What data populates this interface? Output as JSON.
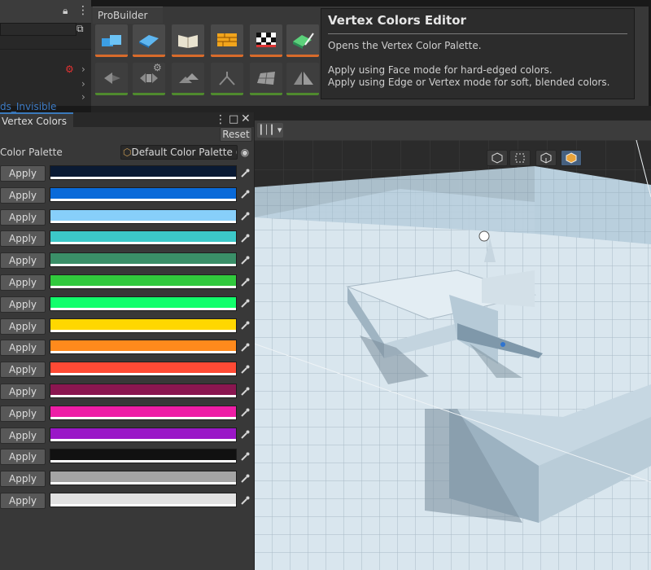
{
  "probuilder": {
    "tab_label": "ProBuilder",
    "tool_icons_row1": [
      "new-shape-icon",
      "new-poly-shape-icon",
      "uv-editor-icon",
      "smoothing-icon",
      "material-editor-icon",
      "vertex-colors-icon"
    ],
    "tool_icons_row2": [
      "select-face-loop-icon",
      "extrude-icon",
      "merge-icon",
      "weld-icon",
      "subdivide-icon",
      "flip-icon"
    ]
  },
  "tooltip": {
    "title": "Vertex Colors Editor",
    "line1": "Opens the Vertex Color Palette.",
    "line2": "Apply using Face mode for hard-edged colors.",
    "line3": "Apply using Edge or Vertex mode for soft, blended colors."
  },
  "hierarchy": {
    "link_text": "ds_Invisible"
  },
  "vertex_colors": {
    "tab_label": "Vertex Colors",
    "reset_label": "Reset",
    "palette_label": "Color Palette",
    "palette_value": "Default Color Palette (",
    "apply_label": "Apply",
    "colors": [
      "#0a1a33",
      "#0a6ad9",
      "#87cffa",
      "#3cc8c8",
      "#3a8f68",
      "#31c93d",
      "#12ff6c",
      "#ffd700",
      "#ff8a1c",
      "#ff4a35",
      "#8a1650",
      "#ee1ea6",
      "#9a17c7",
      "#111111",
      "#a4a4a4",
      "#e2e2e2"
    ]
  },
  "scene": {
    "dropdown_icon": "audio-waveform-icon",
    "mode_buttons": [
      "object-mode-icon",
      "vertex-mode-icon",
      "edge-mode-icon",
      "face-mode-icon"
    ],
    "active_mode_index": 3
  }
}
